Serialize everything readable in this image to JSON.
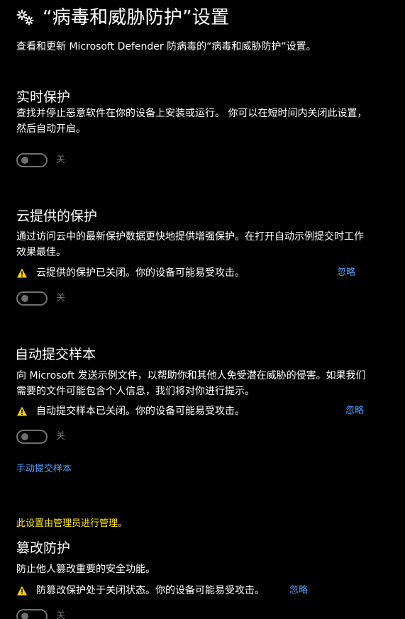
{
  "header": {
    "icon": "gear-icon",
    "title": "“病毒和威胁防护”设置",
    "subtitle": "查看和更新 Microsoft Defender 防病毒的“病毒和威胁防护”设置。"
  },
  "colors": {
    "background": "#000000",
    "text": "#ffffff",
    "link": "#4ba0ff",
    "warning_icon": "#ffd000",
    "admin_note": "#ffea00",
    "toggle_off": "#6f6f6f"
  },
  "sections": [
    {
      "title": "实时保护",
      "description": "查找并停止恶意软件在你的设备上安装或运行。 你可以在短时间内关闭此设置，然后自动开启。",
      "toggle": {
        "state": "off",
        "label": "关"
      }
    },
    {
      "title": "云提供的保护",
      "description": "通过访问云中的最新保护数据更快地提供增强保护。在打开自动示例提交时工作效果最佳。",
      "warning": {
        "icon": "warning-icon",
        "text": "云提供的保护已关闭。你的设备可能易受攻击。",
        "dismiss": "忽略"
      },
      "toggle": {
        "state": "off",
        "label": "关"
      }
    },
    {
      "title": "自动提交样本",
      "description": "向 Microsoft 发送示例文件，以帮助你和其他人免受潜在威胁的侵害。如果我们需要的文件可能包含个人信息，我们将对你进行提示。",
      "warning": {
        "icon": "warning-icon",
        "text": "自动提交样本已关闭。你的设备可能易受攻击。",
        "dismiss": "忽略"
      },
      "toggle": {
        "state": "off",
        "label": "关"
      },
      "link": "手动提交样本"
    },
    {
      "admin_note": "此设置由管理员进行管理。",
      "title": "篡改防护",
      "description": "防止他人篡改重要的安全功能。",
      "warning": {
        "icon": "warning-icon",
        "text": "防篡改保护处于关闭状态。你的设备可能易受攻击。",
        "dismiss": "忽略"
      },
      "toggle": {
        "state": "off",
        "label": "关"
      }
    }
  ]
}
